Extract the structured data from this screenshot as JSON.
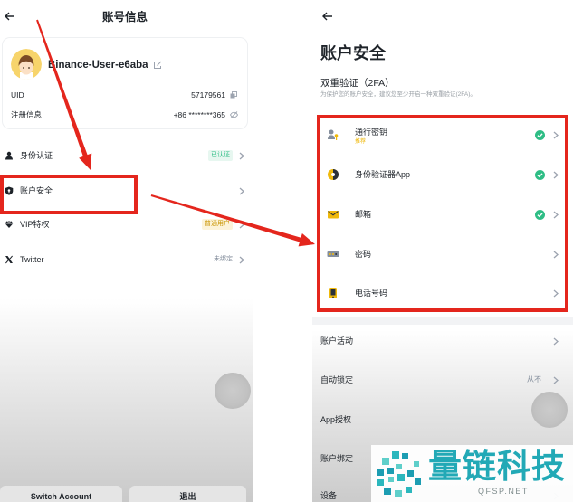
{
  "left_screen": {
    "header": {
      "title": "账号信息",
      "back_icon": "arrow-left-icon"
    },
    "profile": {
      "avatar_icon": "avatar-icon",
      "username": "Binance-User-e6aba",
      "uid_label": "UID",
      "uid_value": "57179561",
      "reg_label": "注册信息",
      "reg_value": "+86 ********365"
    },
    "menu": [
      {
        "icon": "user-icon",
        "label": "身份认证",
        "status": "已认证"
      },
      {
        "icon": "shield-icon",
        "label": "账户安全"
      },
      {
        "icon": "vip-icon",
        "label": "VIP特权",
        "status": "普通用户"
      },
      {
        "icon": "x-logo-icon",
        "label": "Twitter",
        "status": "未绑定"
      }
    ],
    "footer": {
      "switch_account": "Switch Account",
      "logout": "退出"
    }
  },
  "right_screen": {
    "header": {
      "back_icon": "arrow-left-icon"
    },
    "title": "账户安全",
    "two_factor": {
      "heading": "双重验证（2FA）",
      "note": "为保护您的账户安全，建议您至少开启一种双重验证(2FA)。",
      "items": [
        {
          "icon": "passkey-icon",
          "label": "通行密钥",
          "tag": "推荐",
          "enabled": true
        },
        {
          "icon": "authenticator-icon",
          "label": "身份验证器App",
          "enabled": true
        },
        {
          "icon": "mail-icon",
          "label": "邮箱",
          "enabled": true
        },
        {
          "icon": "password-icon",
          "label": "密码",
          "enabled": false
        },
        {
          "icon": "phone-icon",
          "label": "电话号码",
          "enabled": false
        }
      ]
    },
    "settings": [
      {
        "label": "账户活动"
      },
      {
        "label": "自动锁定",
        "value": "从不"
      },
      {
        "label": "App授权"
      },
      {
        "label": "账户绑定"
      },
      {
        "label": "设备"
      }
    ]
  },
  "watermark": {
    "brand": "量链科技",
    "domain": "QFSP.NET"
  },
  "colors": {
    "text": "#1e2329",
    "success_green": "#2ebd85",
    "brand_yellow": "#f0b90b",
    "annotation_red": "#e4261d",
    "watermark_teal": "#22a9b6"
  }
}
